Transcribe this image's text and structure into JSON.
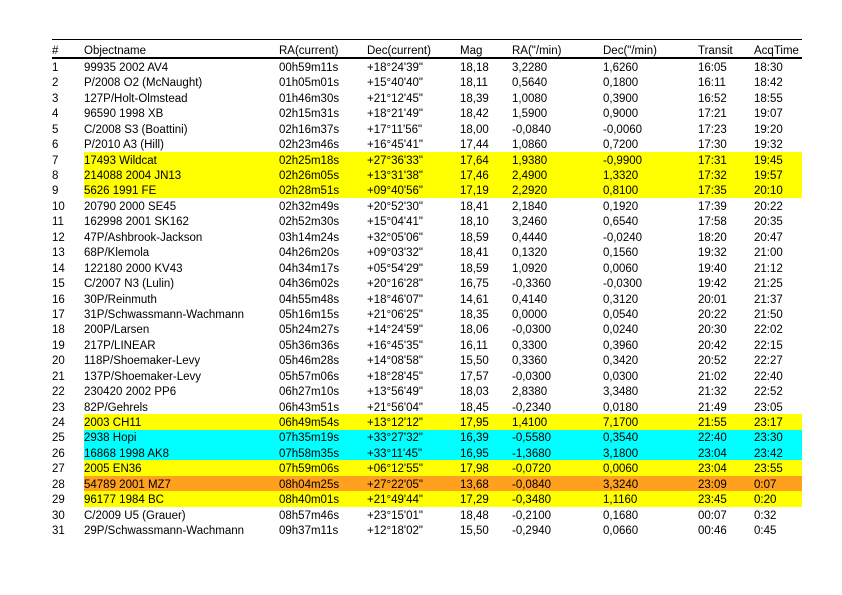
{
  "table": {
    "columns": [
      {
        "key": "num",
        "label": "#"
      },
      {
        "key": "name",
        "label": "Objectname"
      },
      {
        "key": "ra",
        "label": "RA(current)"
      },
      {
        "key": "dec",
        "label": "Dec(current)"
      },
      {
        "key": "mag",
        "label": "Mag"
      },
      {
        "key": "ramin",
        "label": "RA(\"/min)"
      },
      {
        "key": "decmin",
        "label": "Dec(\"/min)"
      },
      {
        "key": "transit",
        "label": "Transit"
      },
      {
        "key": "acq",
        "label": "AcqTime"
      }
    ],
    "highlight_colors": {
      "yellow": "#FFFF00",
      "cyan": "#00FFFF",
      "orange": "#FFA01E",
      "none": "#FFFFFF"
    },
    "rows": [
      {
        "num": "1",
        "name": "99935 2002 AV4",
        "ra": "00h59m11s",
        "dec": "+18°24'39\"",
        "mag": "18,18",
        "ramin": "3,2280",
        "decmin": "1,6260",
        "transit": "16:05",
        "acq": "18:30",
        "highlight": "none"
      },
      {
        "num": "2",
        "name": "P/2008 O2 (McNaught)",
        "ra": "01h05m01s",
        "dec": "+15°40'40\"",
        "mag": "18,11",
        "ramin": "0,5640",
        "decmin": "0,1800",
        "transit": "16:11",
        "acq": "18:42",
        "highlight": "none"
      },
      {
        "num": "3",
        "name": "127P/Holt-Olmstead",
        "ra": "01h46m30s",
        "dec": "+21°12'45\"",
        "mag": "18,39",
        "ramin": "1,0080",
        "decmin": "0,3900",
        "transit": "16:52",
        "acq": "18:55",
        "highlight": "none"
      },
      {
        "num": "4",
        "name": "96590 1998 XB",
        "ra": "02h15m31s",
        "dec": "+18°21'49\"",
        "mag": "18,42",
        "ramin": "1,5900",
        "decmin": "0,9000",
        "transit": "17:21",
        "acq": "19:07",
        "highlight": "none"
      },
      {
        "num": "5",
        "name": "C/2008 S3 (Boattini)",
        "ra": "02h16m37s",
        "dec": "+17°11'56\"",
        "mag": "18,00",
        "ramin": "-0,0840",
        "decmin": "-0,0060",
        "transit": "17:23",
        "acq": "19:20",
        "highlight": "none"
      },
      {
        "num": "6",
        "name": "P/2010 A3 (Hill)",
        "ra": "02h23m46s",
        "dec": "+16°45'41\"",
        "mag": "17,44",
        "ramin": "1,0860",
        "decmin": "0,7200",
        "transit": "17:30",
        "acq": "19:32",
        "highlight": "none"
      },
      {
        "num": "7",
        "name": "17493 Wildcat",
        "ra": "02h25m18s",
        "dec": "+27°36'33\"",
        "mag": "17,64",
        "ramin": "1,9380",
        "decmin": "-0,9900",
        "transit": "17:31",
        "acq": "19:45",
        "highlight": "yellow"
      },
      {
        "num": "8",
        "name": "214088 2004 JN13",
        "ra": "02h26m05s",
        "dec": "+13°31'38\"",
        "mag": "17,46",
        "ramin": "2,4900",
        "decmin": "1,3320",
        "transit": "17:32",
        "acq": "19:57",
        "highlight": "yellow"
      },
      {
        "num": "9",
        "name": "5626 1991 FE",
        "ra": "02h28m51s",
        "dec": "+09°40'56\"",
        "mag": "17,19",
        "ramin": "2,2920",
        "decmin": "0,8100",
        "transit": "17:35",
        "acq": "20:10",
        "highlight": "yellow"
      },
      {
        "num": "10",
        "name": "20790 2000 SE45",
        "ra": "02h32m49s",
        "dec": "+20°52'30\"",
        "mag": "18,41",
        "ramin": "2,1840",
        "decmin": "0,1920",
        "transit": "17:39",
        "acq": "20:22",
        "highlight": "none"
      },
      {
        "num": "11",
        "name": "162998 2001 SK162",
        "ra": "02h52m30s",
        "dec": "+15°04'41\"",
        "mag": "18,10",
        "ramin": "3,2460",
        "decmin": "0,6540",
        "transit": "17:58",
        "acq": "20:35",
        "highlight": "none"
      },
      {
        "num": "12",
        "name": "47P/Ashbrook-Jackson",
        "ra": "03h14m24s",
        "dec": "+32°05'06\"",
        "mag": "18,59",
        "ramin": "0,4440",
        "decmin": "-0,0240",
        "transit": "18:20",
        "acq": "20:47",
        "highlight": "none"
      },
      {
        "num": "13",
        "name": "68P/Klemola",
        "ra": "04h26m20s",
        "dec": "+09°03'32\"",
        "mag": "18,41",
        "ramin": "0,1320",
        "decmin": "0,1560",
        "transit": "19:32",
        "acq": "21:00",
        "highlight": "none"
      },
      {
        "num": "14",
        "name": "122180 2000 KV43",
        "ra": "04h34m17s",
        "dec": "+05°54'29\"",
        "mag": "18,59",
        "ramin": "1,0920",
        "decmin": "0,0060",
        "transit": "19:40",
        "acq": "21:12",
        "highlight": "none"
      },
      {
        "num": "15",
        "name": "C/2007 N3 (Lulin)",
        "ra": "04h36m02s",
        "dec": "+20°16'28\"",
        "mag": "16,75",
        "ramin": "-0,3360",
        "decmin": "-0,0300",
        "transit": "19:42",
        "acq": "21:25",
        "highlight": "none"
      },
      {
        "num": "16",
        "name": "30P/Reinmuth",
        "ra": "04h55m48s",
        "dec": "+18°46'07\"",
        "mag": "14,61",
        "ramin": "0,4140",
        "decmin": "0,3120",
        "transit": "20:01",
        "acq": "21:37",
        "highlight": "none"
      },
      {
        "num": "17",
        "name": "31P/Schwassmann-Wachmann",
        "ra": "05h16m15s",
        "dec": "+21°06'25\"",
        "mag": "18,35",
        "ramin": "0,0000",
        "decmin": "0,0540",
        "transit": "20:22",
        "acq": "21:50",
        "highlight": "none"
      },
      {
        "num": "18",
        "name": "200P/Larsen",
        "ra": "05h24m27s",
        "dec": "+14°24'59\"",
        "mag": "18,06",
        "ramin": "-0,0300",
        "decmin": "0,0240",
        "transit": "20:30",
        "acq": "22:02",
        "highlight": "none"
      },
      {
        "num": "19",
        "name": "217P/LINEAR",
        "ra": "05h36m36s",
        "dec": "+16°45'35\"",
        "mag": "16,11",
        "ramin": "0,3300",
        "decmin": "0,3960",
        "transit": "20:42",
        "acq": "22:15",
        "highlight": "none"
      },
      {
        "num": "20",
        "name": "118P/Shoemaker-Levy",
        "ra": "05h46m28s",
        "dec": "+14°08'58\"",
        "mag": "15,50",
        "ramin": "0,3360",
        "decmin": "0,3420",
        "transit": "20:52",
        "acq": "22:27",
        "highlight": "none"
      },
      {
        "num": "21",
        "name": "137P/Shoemaker-Levy",
        "ra": "05h57m06s",
        "dec": "+18°28'45\"",
        "mag": "17,57",
        "ramin": "-0,0300",
        "decmin": "0,0300",
        "transit": "21:02",
        "acq": "22:40",
        "highlight": "none"
      },
      {
        "num": "22",
        "name": "230420 2002 PP6",
        "ra": "06h27m10s",
        "dec": "+13°56'49\"",
        "mag": "18,03",
        "ramin": "2,8380",
        "decmin": "3,3480",
        "transit": "21:32",
        "acq": "22:52",
        "highlight": "none"
      },
      {
        "num": "23",
        "name": "82P/Gehrels",
        "ra": "06h43m51s",
        "dec": "+21°56'04\"",
        "mag": "18,45",
        "ramin": "-0,2340",
        "decmin": "0,0180",
        "transit": "21:49",
        "acq": "23:05",
        "highlight": "none"
      },
      {
        "num": "24",
        "name": "2003 CH11",
        "ra": "06h49m54s",
        "dec": "+13°12'12\"",
        "mag": "17,95",
        "ramin": "1,4100",
        "decmin": "7,1700",
        "transit": "21:55",
        "acq": "23:17",
        "highlight": "yellow"
      },
      {
        "num": "25",
        "name": "2938 Hopi",
        "ra": "07h35m19s",
        "dec": "+33°27'32\"",
        "mag": "16,39",
        "ramin": "-0,5580",
        "decmin": "0,3540",
        "transit": "22:40",
        "acq": "23:30",
        "highlight": "cyan"
      },
      {
        "num": "26",
        "name": "16868 1998 AK8",
        "ra": "07h58m35s",
        "dec": "+33°11'45\"",
        "mag": "16,95",
        "ramin": "-1,3680",
        "decmin": "3,1800",
        "transit": "23:04",
        "acq": "23:42",
        "highlight": "cyan"
      },
      {
        "num": "27",
        "name": "2005 EN36",
        "ra": "07h59m06s",
        "dec": "+06°12'55\"",
        "mag": "17,98",
        "ramin": "-0,0720",
        "decmin": "0,0060",
        "transit": "23:04",
        "acq": "23:55",
        "highlight": "yellow"
      },
      {
        "num": "28",
        "name": "54789 2001 MZ7",
        "ra": "08h04m25s",
        "dec": "+27°22'05\"",
        "mag": "13,68",
        "ramin": "-0,0840",
        "decmin": "3,3240",
        "transit": "23:09",
        "acq": "0:07",
        "highlight": "orange"
      },
      {
        "num": "29",
        "name": "96177 1984 BC",
        "ra": "08h40m01s",
        "dec": "+21°49'44\"",
        "mag": "17,29",
        "ramin": "-0,3480",
        "decmin": "1,1160",
        "transit": "23:45",
        "acq": "0:20",
        "highlight": "yellow"
      },
      {
        "num": "30",
        "name": "C/2009 U5 (Grauer)",
        "ra": "08h57m46s",
        "dec": "+23°15'01\"",
        "mag": "18,48",
        "ramin": "-0,2100",
        "decmin": "0,1680",
        "transit": "00:07",
        "acq": "0:32",
        "highlight": "none"
      },
      {
        "num": "31",
        "name": "29P/Schwassmann-Wachmann",
        "ra": "09h37m11s",
        "dec": "+12°18'02\"",
        "mag": "15,50",
        "ramin": "-0,2940",
        "decmin": "0,0660",
        "transit": "00:46",
        "acq": "0:45",
        "highlight": "none"
      }
    ]
  }
}
